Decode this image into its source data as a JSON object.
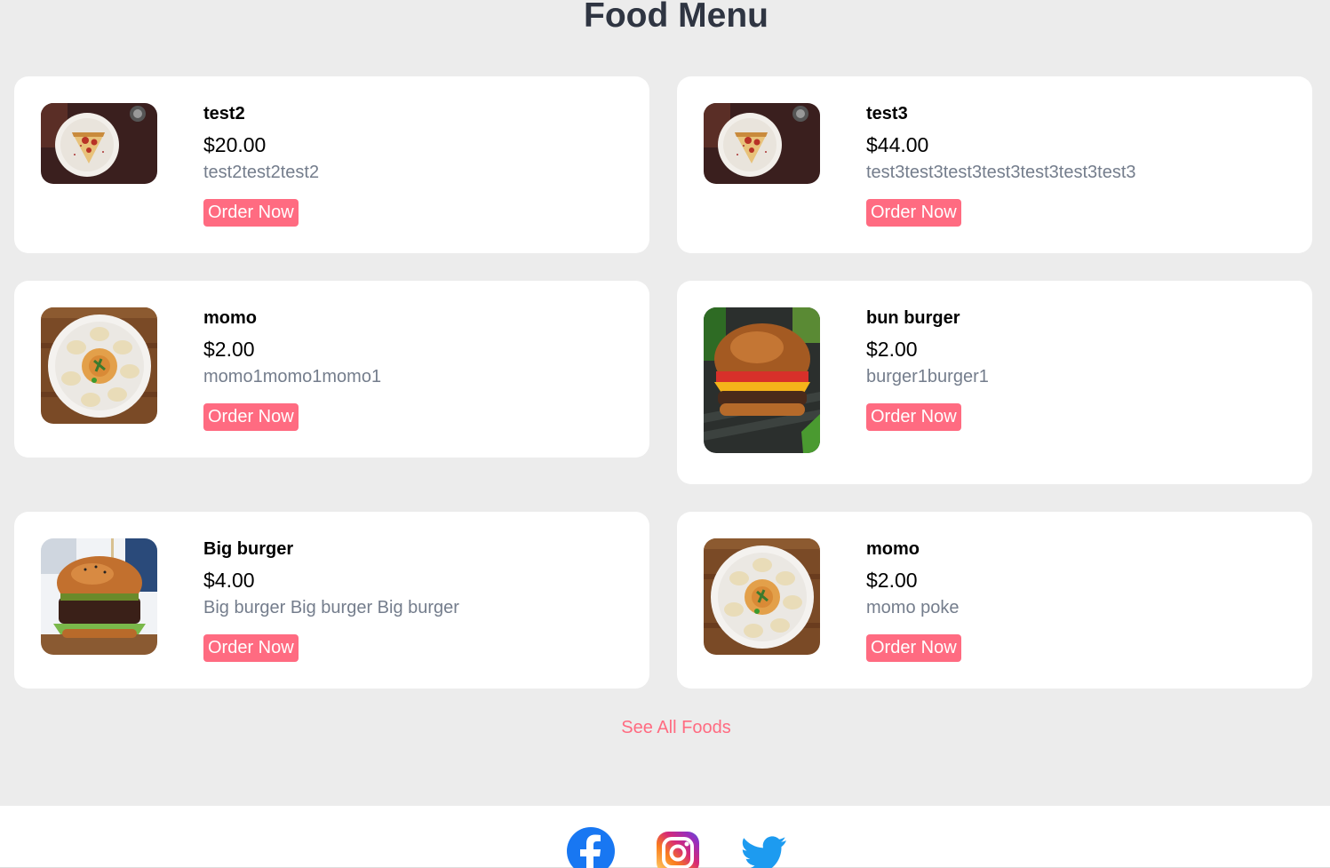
{
  "page": {
    "title": "Food Menu"
  },
  "foods": [
    {
      "name": "test2",
      "price": "$20.00",
      "description": "test2test2test2",
      "order_label": "Order Now",
      "image": "pizza-photo"
    },
    {
      "name": "test3",
      "price": "$44.00",
      "description": "test3test3test3test3test3test3test3",
      "order_label": "Order Now",
      "image": "pizza-photo"
    },
    {
      "name": "momo",
      "price": "$2.00",
      "description": "momo1momo1momo1",
      "order_label": "Order Now",
      "image": "momo-photo"
    },
    {
      "name": "bun burger",
      "price": "$2.00",
      "description": "burger1burger1",
      "order_label": "Order Now",
      "image": "burger-photo"
    },
    {
      "name": "Big burger",
      "price": "$4.00",
      "description": "Big burger Big burger Big burger",
      "order_label": "Order Now",
      "image": "big-burger-photo"
    },
    {
      "name": "momo",
      "price": "$2.00",
      "description": "momo poke",
      "order_label": "Order Now",
      "image": "momo-photo"
    }
  ],
  "see_all_label": "See All Foods",
  "footer": {
    "social": [
      {
        "icon": "facebook-icon",
        "color": "#1877f2"
      },
      {
        "icon": "instagram-icon",
        "color": "#c13584"
      },
      {
        "icon": "twitter-icon",
        "color": "#1d9bf0"
      }
    ]
  },
  "colors": {
    "accent": "#ff6b81",
    "title": "#2f3542",
    "muted": "#747d8c",
    "background": "#ececec"
  }
}
